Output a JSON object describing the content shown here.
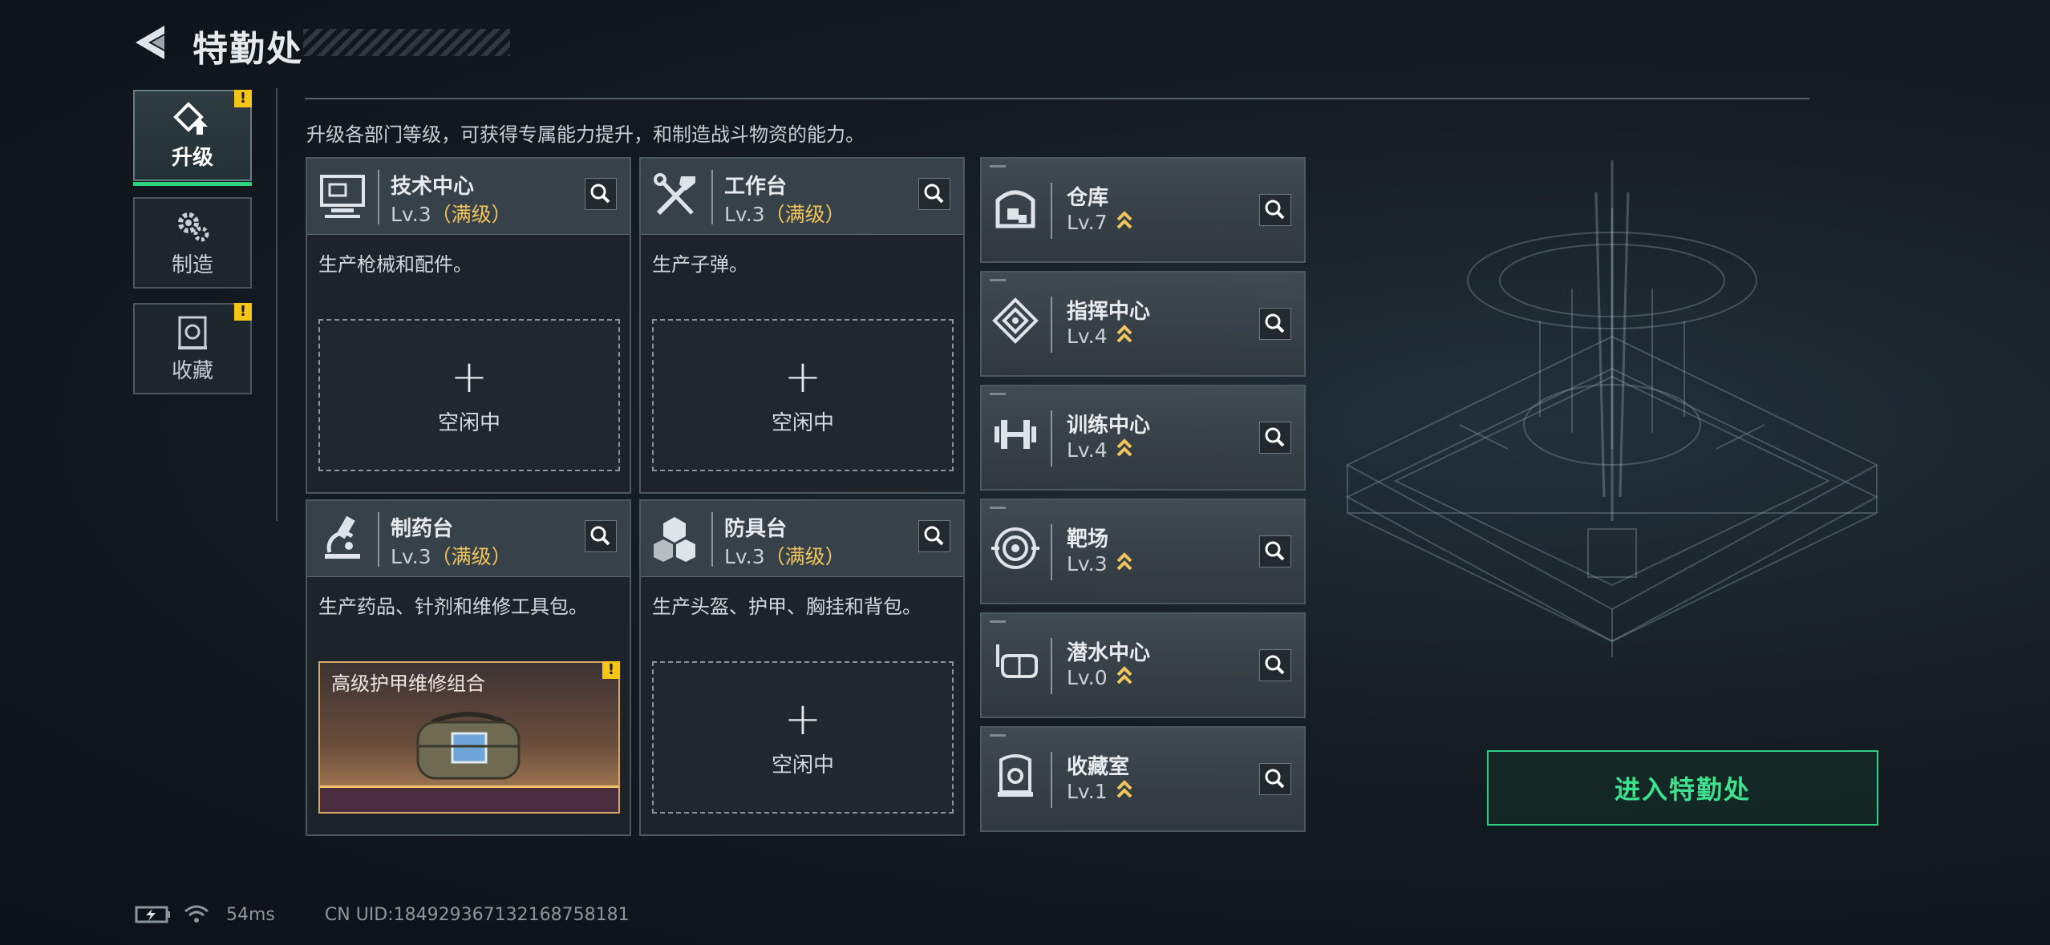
{
  "header": {
    "title": "特勤处"
  },
  "tabs": [
    {
      "label": "升级",
      "active": true,
      "alert": true
    },
    {
      "label": "制造",
      "active": false,
      "alert": false
    },
    {
      "label": "收藏",
      "active": false,
      "alert": true
    }
  ],
  "alert_mark": "!",
  "description": "升级各部门等级，可获得专属能力提升，和制造战斗物资的能力。",
  "departments": [
    {
      "name": "技术中心",
      "level": "Lv.3",
      "status": "（满级）",
      "text": "生产枪械和配件。",
      "slot_plus": "+",
      "slot_state": "空闲中",
      "icon": "monitor-icon"
    },
    {
      "name": "工作台",
      "level": "Lv.3",
      "status": "（满级）",
      "text": "生产子弹。",
      "slot_plus": "+",
      "slot_state": "空闲中",
      "icon": "tools-icon"
    },
    {
      "name": "制药台",
      "level": "Lv.3",
      "status": "（满级）",
      "text": "生产药品、针剂和维修工具包。",
      "product": "高级护甲维修组合",
      "icon": "microscope-icon"
    },
    {
      "name": "防具台",
      "level": "Lv.3",
      "status": "（满级）",
      "text": "生产头盔、护甲、胸挂和背包。",
      "slot_plus": "+",
      "slot_state": "空闲中",
      "icon": "armor-icon"
    }
  ],
  "facilities": [
    {
      "name": "仓库",
      "level": "Lv.7",
      "icon": "warehouse-icon"
    },
    {
      "name": "指挥中心",
      "level": "Lv.4",
      "icon": "command-icon"
    },
    {
      "name": "训练中心",
      "level": "Lv.4",
      "icon": "dumbbell-icon"
    },
    {
      "name": "靶场",
      "level": "Lv.3",
      "icon": "target-icon"
    },
    {
      "name": "潜水中心",
      "level": "Lv.0",
      "icon": "diving-mask-icon"
    },
    {
      "name": "收藏室",
      "level": "Lv.1",
      "icon": "collection-icon"
    }
  ],
  "enter_button": "进入特勤处",
  "status": {
    "ping": "54ms",
    "uid": "CN UID:18492936713216875818​1"
  },
  "colors": {
    "accent_green": "#2fd27f",
    "max_gold": "#f2c55c",
    "alert_yellow": "#f5c518"
  }
}
